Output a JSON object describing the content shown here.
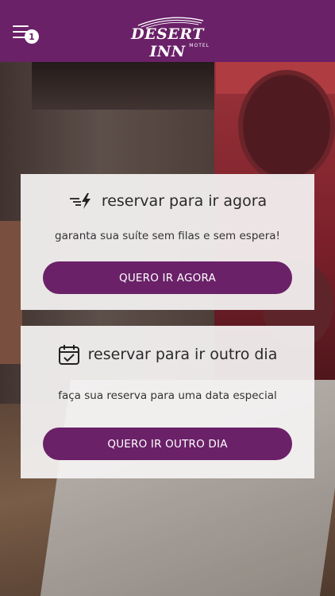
{
  "header": {
    "menu_badge": "1",
    "logo": {
      "name": "DESERT INN",
      "sub": "MOTEL"
    }
  },
  "cards": [
    {
      "icon": "fast-lightning-icon",
      "title": "reservar para ir agora",
      "subtitle": "garanta sua suíte sem filas e sem espera!",
      "button": "QUERO IR AGORA"
    },
    {
      "icon": "calendar-check-icon",
      "title": "reservar para ir outro dia",
      "subtitle": "faça sua reserva para uma data especial",
      "button": "QUERO IR OUTRO DIA"
    }
  ],
  "colors": {
    "brand": "#6a2168"
  }
}
